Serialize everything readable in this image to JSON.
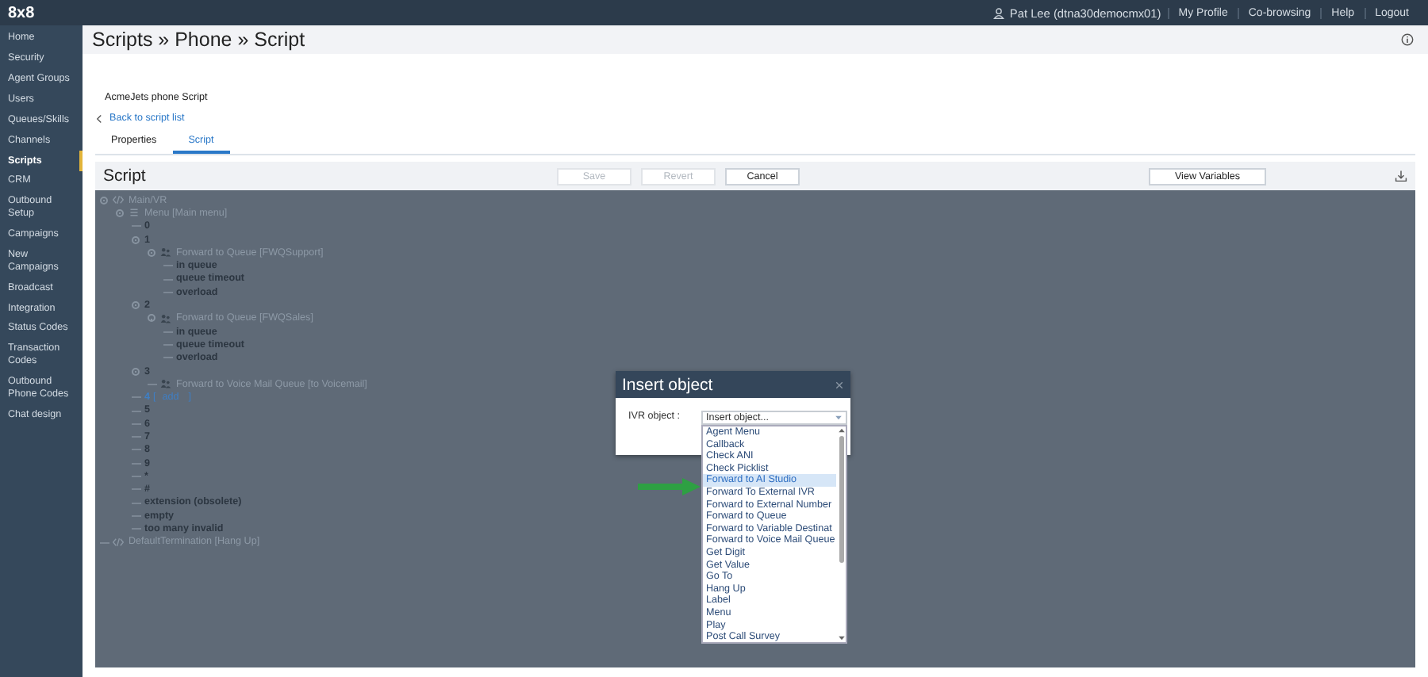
{
  "brand": "8x8",
  "top_bar": {
    "user": "Pat Lee (dtna30democmx01)",
    "links": [
      "My Profile",
      "Co-browsing",
      "Help",
      "Logout"
    ]
  },
  "sidebar": {
    "items": [
      {
        "label": "Home",
        "selected": false
      },
      {
        "label": "Security",
        "selected": false
      },
      {
        "label": "Agent Groups",
        "selected": false
      },
      {
        "label": "Users",
        "selected": false
      },
      {
        "label": "Queues/Skills",
        "selected": false
      },
      {
        "label": "Channels",
        "selected": false
      },
      {
        "label": "Scripts",
        "selected": true
      },
      {
        "label": "CRM",
        "selected": false
      },
      {
        "label": "Outbound Setup",
        "selected": false
      },
      {
        "label": "Campaigns",
        "selected": false
      },
      {
        "label": "New Campaigns",
        "selected": false
      },
      {
        "label": "Broadcast",
        "selected": false
      },
      {
        "label": "Integration",
        "selected": false
      },
      {
        "label": "Status Codes",
        "selected": false
      },
      {
        "label": "Transaction Codes",
        "selected": false
      },
      {
        "label": "Outbound Phone Codes",
        "selected": false
      },
      {
        "label": "Chat design",
        "selected": false
      }
    ]
  },
  "page": {
    "breadcrumb": "Scripts » Phone » Script",
    "script_name": "AcmeJets phone Script",
    "back_link": "Back to script list",
    "tabs": [
      {
        "label": "Properties",
        "selected": false
      },
      {
        "label": "Script",
        "selected": true
      }
    ]
  },
  "script_panel": {
    "title": "Script",
    "buttons": [
      {
        "label": "Save",
        "disabled": true
      },
      {
        "label": "Revert",
        "disabled": true
      },
      {
        "label": "Cancel",
        "disabled": false
      }
    ],
    "view_button": "View Variables",
    "tree": [
      {
        "kind": "script",
        "label": "Main/VR",
        "expanded": true,
        "children": [
          {
            "kind": "menu",
            "label": "Menu [Main menu]",
            "expanded": true,
            "children": [
              {
                "kind": "key",
                "label": "0"
              },
              {
                "kind": "key",
                "label": "1",
                "expanded": true,
                "children": [
                  {
                    "kind": "queue",
                    "label": "Forward to Queue [FWQSupport]",
                    "expanded": true,
                    "children": [
                      {
                        "kind": "key",
                        "label": "in queue"
                      },
                      {
                        "kind": "key",
                        "label": "queue timeout"
                      },
                      {
                        "kind": "key",
                        "label": "overload"
                      }
                    ]
                  }
                ]
              },
              {
                "kind": "key",
                "label": "2",
                "expanded": true,
                "children": [
                  {
                    "kind": "queue",
                    "label": "Forward to Queue [FWQSales]",
                    "expanded": true,
                    "children": [
                      {
                        "kind": "key",
                        "label": "in queue"
                      },
                      {
                        "kind": "key",
                        "label": "queue timeout"
                      },
                      {
                        "kind": "key",
                        "label": "overload"
                      }
                    ]
                  }
                ]
              },
              {
                "kind": "key",
                "label": "3",
                "expanded": true,
                "children": [
                  {
                    "kind": "queue",
                    "label": "Forward to Voice Mail Queue [to Voicemail]"
                  }
                ]
              },
              {
                "kind": "add",
                "label": "4",
                "brackets": [
                  "[",
                  "]"
                ],
                "link": "add"
              },
              {
                "kind": "key",
                "label": "5"
              },
              {
                "kind": "key",
                "label": "6"
              },
              {
                "kind": "key",
                "label": "7"
              },
              {
                "kind": "key",
                "label": "8"
              },
              {
                "kind": "key",
                "label": "9"
              },
              {
                "kind": "key",
                "label": "*"
              },
              {
                "kind": "key",
                "label": "#"
              },
              {
                "kind": "key",
                "label": "extension (obsolete)"
              },
              {
                "kind": "key",
                "label": "empty"
              },
              {
                "kind": "key",
                "label": "too many invalid"
              }
            ]
          }
        ]
      },
      {
        "kind": "script",
        "label": "DefaultTermination [Hang Up]"
      }
    ]
  },
  "dialog": {
    "title": "Insert object",
    "field_label": "IVR object :",
    "select_value": "Insert object...",
    "options": [
      {
        "label": "Agent Menu",
        "selected": false
      },
      {
        "label": "Callback",
        "selected": false
      },
      {
        "label": "Check ANI",
        "selected": false
      },
      {
        "label": "Check Picklist",
        "selected": false
      },
      {
        "label": "Forward to AI Studio",
        "selected": true
      },
      {
        "label": "Forward To External IVR",
        "selected": false
      },
      {
        "label": "Forward to External Number",
        "selected": false
      },
      {
        "label": "Forward to Queue",
        "selected": false
      },
      {
        "label": "Forward to Variable Destinat",
        "selected": false
      },
      {
        "label": "Forward to Voice Mail Queue",
        "selected": false
      },
      {
        "label": "Get Digit",
        "selected": false
      },
      {
        "label": "Get Value",
        "selected": false
      },
      {
        "label": "Go To",
        "selected": false
      },
      {
        "label": "Hang Up",
        "selected": false
      },
      {
        "label": "Label",
        "selected": false
      },
      {
        "label": "Menu",
        "selected": false
      },
      {
        "label": "Play",
        "selected": false
      },
      {
        "label": "Post Call Survey",
        "selected": false
      }
    ]
  }
}
